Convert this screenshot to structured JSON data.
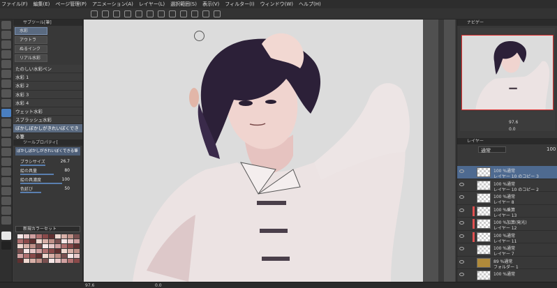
{
  "menubar": {
    "items": [
      "ファイル(F)",
      "編集(E)",
      "ページ管理(P)",
      "アニメーション(A)",
      "レイヤー(L)",
      "選択範囲(S)",
      "表示(V)",
      "フィルター(I)",
      "ウィンドウ(W)",
      "ヘルプ(H)"
    ]
  },
  "subtool": {
    "header": "サブツール[筆]",
    "tabs": [
      "水彩",
      "アウトラ",
      "ぬるインク",
      "リアル水彩"
    ],
    "items": [
      "たのしい水彩ペン",
      "水彩 1",
      "水彩 2",
      "水彩 3",
      "水彩 4",
      "ウェット水彩",
      "スプラッシュ水彩",
      "ぼかしぼかしがきれいぼくできる筆"
    ]
  },
  "toolprop": {
    "header": "ツールプロパティ[",
    "preview": "ぼかしぼかしがきれいぼくできる筆",
    "rows": [
      {
        "label": "ブラシサイズ",
        "value": "26.7",
        "fill": 0.6
      },
      {
        "label": "絵の具量",
        "value": "80",
        "fill": 0.8
      },
      {
        "label": "絵の具濃度",
        "value": "100",
        "fill": 1.0
      },
      {
        "label": "色延び",
        "value": "50",
        "fill": 0.5
      }
    ]
  },
  "colorset": {
    "selected": "新規カラーセット"
  },
  "navigator": {
    "header": "ナビゲー",
    "zoom": "97.6",
    "angle": "0.0"
  },
  "layerprop": {
    "header": "レイヤー",
    "blend_mode": "通常",
    "opacity": "100"
  },
  "layers": [
    {
      "line1": "100 %通常",
      "line2": "レイヤー 10 のコピー 3",
      "selected": true,
      "mask": false,
      "folder": false
    },
    {
      "line1": "100 %通常",
      "line2": "レイヤー 10 のコピー 2",
      "selected": false,
      "mask": false,
      "folder": false
    },
    {
      "line1": "100 %通常",
      "line2": "レイヤー 8",
      "selected": false,
      "mask": false,
      "folder": false
    },
    {
      "line1": "100 %乗算",
      "line2": "レイヤー 13",
      "selected": false,
      "mask": true,
      "folder": false
    },
    {
      "line1": "100 %加算(発光)",
      "line2": "レイヤー 12",
      "selected": false,
      "mask": true,
      "folder": false
    },
    {
      "line1": "100 %通常",
      "line2": "レイヤー 11",
      "selected": false,
      "mask": true,
      "folder": false
    },
    {
      "line1": "100 %通常",
      "line2": "レイヤー 7",
      "selected": false,
      "mask": false,
      "folder": false
    },
    {
      "line1": "89 %通常",
      "line2": "フォルダー 1",
      "selected": false,
      "mask": false,
      "folder": true
    },
    {
      "line1": "100 %通常",
      "line2": "",
      "selected": false,
      "mask": false,
      "folder": false
    }
  ],
  "statusbar": {
    "zoom": "97.6",
    "angle": "0.0"
  }
}
